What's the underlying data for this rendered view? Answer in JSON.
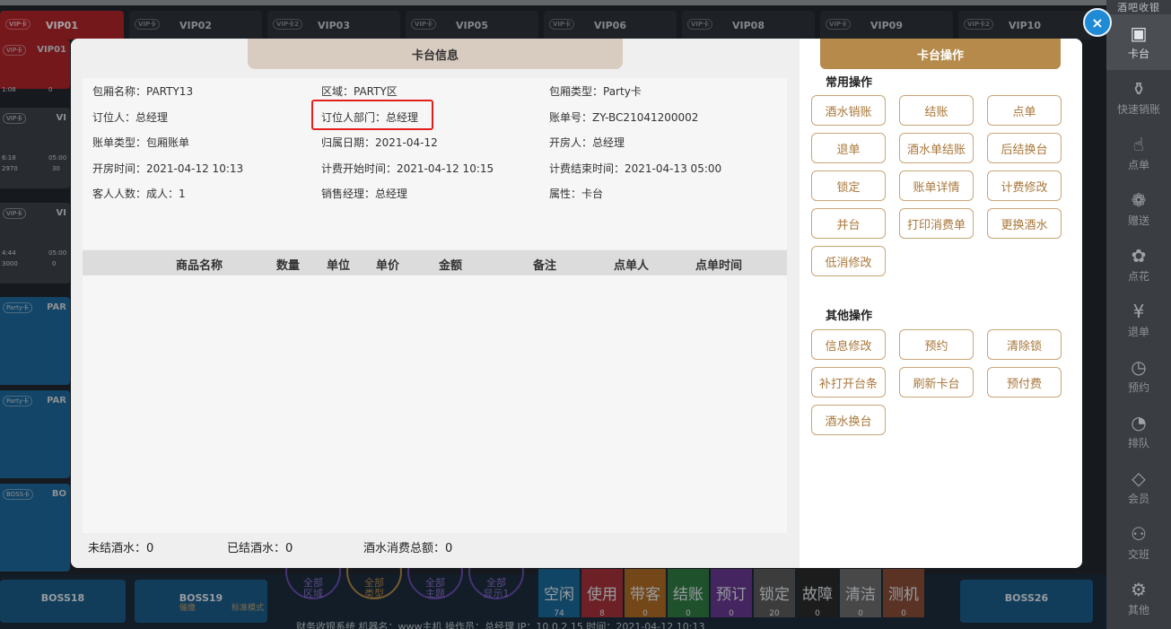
{
  "background": {
    "top_rooms": [
      {
        "tag": "VIP卡",
        "name": "VIP01",
        "state": "red"
      },
      {
        "tag": "VIP卡",
        "name": "VIP02",
        "state": "idle"
      },
      {
        "tag": "VIP卡2",
        "name": "VIP03",
        "state": "idle"
      },
      {
        "tag": "VIP卡",
        "name": "VIP05",
        "state": "idle"
      },
      {
        "tag": "VIP卡",
        "name": "VIP06",
        "state": "idle"
      },
      {
        "tag": "VIP卡",
        "name": "VIP08",
        "state": "idle"
      },
      {
        "tag": "VIP卡",
        "name": "VIP09",
        "state": "idle"
      },
      {
        "tag": "VIP卡2",
        "name": "VIP10",
        "state": "idle"
      }
    ],
    "left_cards": [
      {
        "tag": "VIP卡",
        "name": "VIP01",
        "l1": "1:08",
        "l2": "0",
        "color": "#b2262c"
      },
      {
        "tag": "VIP卡",
        "name": "VI",
        "l1": "6:18",
        "l2": "05:00",
        "l3": "2970",
        "l4": "30",
        "color": "#3e4349"
      },
      {
        "tag": "VIP卡",
        "name": "VI",
        "l1": "4:44",
        "l2": "05:00",
        "l3": "3000",
        "l4": "0",
        "color": "#3e4349"
      },
      {
        "tag": "Party卡",
        "name": "PAR",
        "color": "#1d6a9e"
      },
      {
        "tag": "Party卡",
        "name": "PAR",
        "color": "#1d6a9e"
      },
      {
        "tag": "BOSS卡",
        "name": "BO",
        "color": "#1d6a9e"
      }
    ],
    "bottom_rooms": [
      {
        "tag": "BOSS卡",
        "name": "BOSS18"
      },
      {
        "tag": "BOSS卡",
        "name": "BOSS19"
      },
      {
        "tag": "BOSS卡2",
        "name": "BOSS26"
      }
    ],
    "bottom_icons": [
      {
        "label": "催缴"
      },
      {
        "label": "标准模式"
      }
    ],
    "filter_circles": [
      {
        "label": "全部\n区域"
      },
      {
        "label": "全部\n类型"
      },
      {
        "label": "全部\n主题"
      },
      {
        "label": "全部\n显示1"
      }
    ],
    "status": [
      {
        "label": "空闲",
        "count": "74",
        "color": "#1b6a9c"
      },
      {
        "label": "使用",
        "count": "8",
        "color": "#a8323a"
      },
      {
        "label": "带客",
        "count": "0",
        "color": "#b36d27"
      },
      {
        "label": "结账",
        "count": "0",
        "color": "#2f7d44"
      },
      {
        "label": "预订",
        "count": "0",
        "color": "#6b3a94"
      },
      {
        "label": "锁定",
        "count": "20",
        "color": "#5c5c5c"
      },
      {
        "label": "故障",
        "count": "0",
        "color": "#2b2b2b"
      },
      {
        "label": "清洁",
        "count": "0",
        "color": "#6f6f6f"
      },
      {
        "label": "测机",
        "count": "0",
        "color": "#8b4f3a"
      }
    ],
    "footer": "财务收银系统    机器名：www主机    操作员：总经理    IP：10.0.2.15    时间：2021-04-12 10:13"
  },
  "sidebar": {
    "title": "酒吧收银",
    "items": [
      {
        "label": "卡台",
        "icon": "table-icon",
        "glyph": "▣",
        "active": true
      },
      {
        "label": "快速销账",
        "icon": "bottle-icon",
        "glyph": "⚱",
        "active": false
      },
      {
        "label": "点单",
        "icon": "hand-icon",
        "glyph": "☝",
        "active": false
      },
      {
        "label": "赠送",
        "icon": "gift-icon",
        "glyph": "❁",
        "active": false
      },
      {
        "label": "点花",
        "icon": "flower-icon",
        "glyph": "✿",
        "active": false
      },
      {
        "label": "退单",
        "icon": "refund-icon",
        "glyph": "¥",
        "active": false
      },
      {
        "label": "预约",
        "icon": "clock-icon",
        "glyph": "◷",
        "active": false
      },
      {
        "label": "排队",
        "icon": "queue-icon",
        "glyph": "◔",
        "active": false
      },
      {
        "label": "会员",
        "icon": "diamond-icon",
        "glyph": "◇",
        "active": false
      },
      {
        "label": "交班",
        "icon": "users-icon",
        "glyph": "⚇",
        "active": false
      },
      {
        "label": "其他",
        "icon": "gear-icon",
        "glyph": "⚙",
        "active": false
      }
    ]
  },
  "modal": {
    "header": "卡台信息",
    "info": {
      "room_name": "包厢名称：PARTY13",
      "area": "区域：PARTY区",
      "room_type": "包厢类型：Party卡",
      "booker": "订位人：总经理",
      "booker_dept": "订位人部门：总经理",
      "bill_no": "账单号：ZY-BC21041200002",
      "bill_type": "账单类型：包厢账单",
      "belong_date": "归属日期：2021-04-12",
      "opener": "开房人：总经理",
      "open_time": "开房时间：2021-04-12 10:13",
      "billing_start": "计费开始时间：2021-04-12 10:15",
      "billing_end": "计费结束时间：2021-04-13 05:00",
      "guests": "客人人数：成人：1",
      "sales_manager": "销售经理：总经理",
      "attribute": "属性：卡台"
    },
    "table": {
      "columns": [
        "商品名称",
        "数量",
        "单位",
        "单价",
        "金额",
        "备注",
        "点单人",
        "点单时间"
      ],
      "rows": []
    },
    "footer": {
      "unsettled": "未结酒水：0",
      "settled": "已结酒水：0",
      "total": "酒水消费总额：0"
    }
  },
  "operations": {
    "header": "卡台操作",
    "common_title": "常用操作",
    "common": [
      "酒水销账",
      "结账",
      "点单",
      "退单",
      "酒水单结账",
      "后结换台",
      "锁定",
      "账单详情",
      "计费修改",
      "并台",
      "打印消费单",
      "更换酒水",
      "低消修改"
    ],
    "other_title": "其他操作",
    "other": [
      "信息修改",
      "预约",
      "清除锁",
      "补打开台条",
      "刷新卡台",
      "预付费",
      "酒水换台"
    ]
  },
  "close_label": "×"
}
